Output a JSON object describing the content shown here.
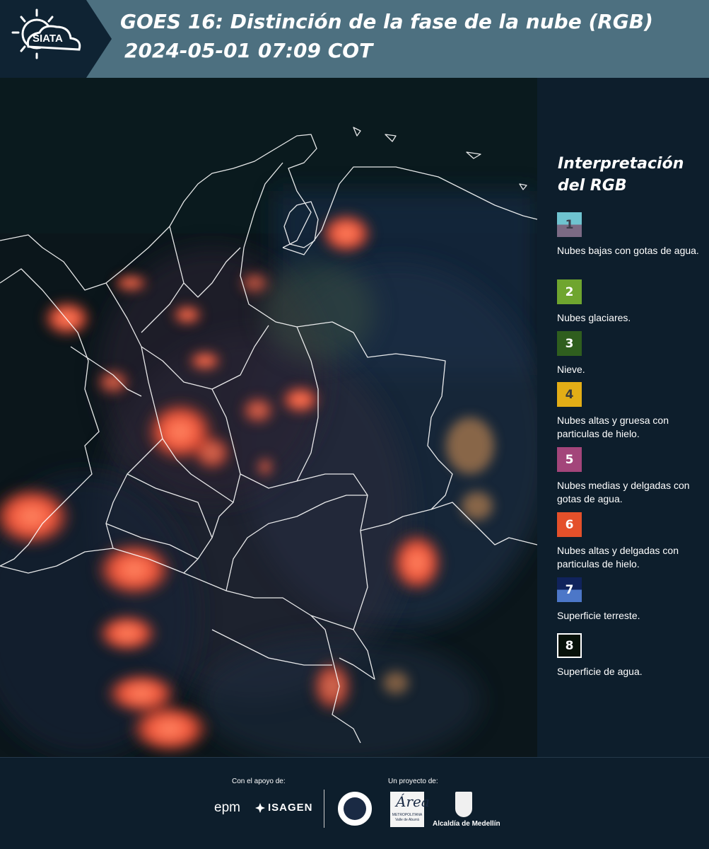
{
  "header": {
    "logo_text": "SIATA",
    "title_line1": "GOES 16: Distinción de la fase de la nube (RGB)",
    "title_line2": "2024-05-01 07:09 COT"
  },
  "legend": {
    "title": "Interpretación del RGB",
    "items": [
      {
        "number": "1",
        "label": "Nubes bajas con gotas de agua.",
        "color_top": "#6fc3d0",
        "color_bottom": "#7b6a84"
      },
      {
        "number": "2",
        "label": "Nubes glaciares.",
        "color": "#6fa52f"
      },
      {
        "number": "3",
        "label": "Nieve.",
        "color": "#2f5e1e"
      },
      {
        "number": "4",
        "label": "Nubes altas y gruesa con particulas de hielo.",
        "color": "#e3ad16"
      },
      {
        "number": "5",
        "label": "Nubes medias y delgadas con gotas de agua.",
        "color": "#a3457a"
      },
      {
        "number": "6",
        "label": "Nubes altas y delgadas con particulas de hielo.",
        "color": "#e4502a"
      },
      {
        "number": "7",
        "label": "Superficie terreste.",
        "color_top": "#10235c",
        "color_bottom": "#4c77c8"
      },
      {
        "number": "8",
        "label": "Superficie de agua.",
        "color": "#08120a"
      }
    ]
  },
  "footer": {
    "support_label": "Con el apoyo de:",
    "project_label": "Un proyecto de:",
    "sponsor_epm": "epm",
    "sponsor_isagen": "ISAGEN",
    "area_logo_letter": "Área",
    "area_logo_sub": "METROPOLITANA Valle de Aburrá",
    "alcaldia": "Alcaldía de Medellín"
  }
}
